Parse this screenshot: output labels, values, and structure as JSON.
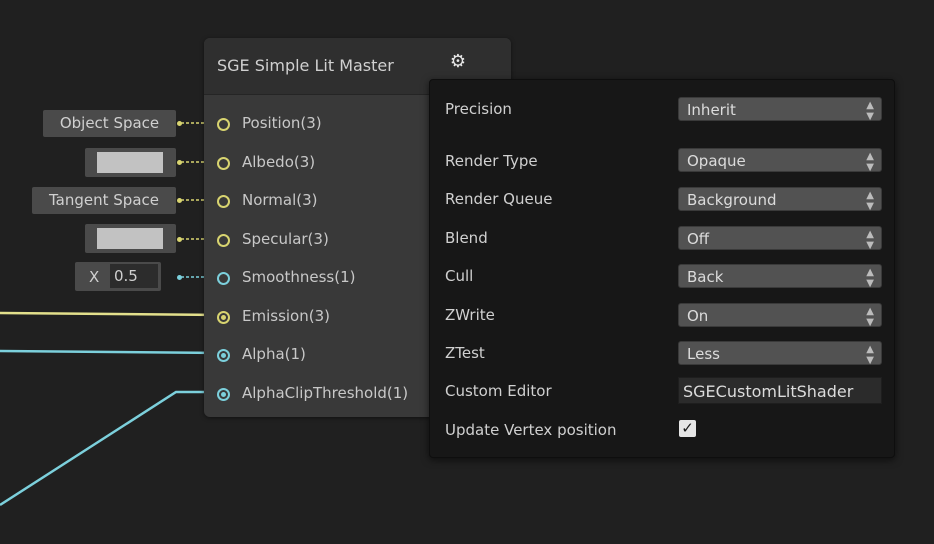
{
  "node": {
    "title": "SGE Simple Lit Master",
    "settings_icon": "gear-icon",
    "ports": [
      {
        "label": "Position(3)",
        "color": "yellow"
      },
      {
        "label": "Albedo(3)",
        "color": "yellow"
      },
      {
        "label": "Normal(3)",
        "color": "yellow"
      },
      {
        "label": "Specular(3)",
        "color": "yellow"
      },
      {
        "label": "Smoothness(1)",
        "color": "cyan"
      },
      {
        "label": "Emission(3)",
        "color": "yellow"
      },
      {
        "label": "Alpha(1)",
        "color": "cyan"
      },
      {
        "label": "AlphaClipThreshold(1)",
        "color": "cyan"
      }
    ]
  },
  "inline_inputs": {
    "position_space": "Object Space",
    "normal_space": "Tangent Space",
    "smoothness_axis": "X",
    "smoothness_value": "0.5"
  },
  "settings": {
    "precision_label": "Precision",
    "precision_value": "Inherit",
    "render_type_label": "Render Type",
    "render_type_value": "Opaque",
    "render_queue_label": "Render Queue",
    "render_queue_value": "Background",
    "blend_label": "Blend",
    "blend_value": "Off",
    "cull_label": "Cull",
    "cull_value": "Back",
    "zwrite_label": "ZWrite",
    "zwrite_value": "On",
    "ztest_label": "ZTest",
    "ztest_value": "Less",
    "custom_editor_label": "Custom Editor",
    "custom_editor_value": "SGECustomLitShader",
    "update_vertex_label": "Update Vertex position",
    "update_vertex_checked": true
  },
  "colors": {
    "yellow_port": "#d8d470",
    "cyan_port": "#7cd0dc",
    "canvas_bg": "#202020",
    "node_bg": "#393939",
    "popup_bg": "#171717"
  }
}
